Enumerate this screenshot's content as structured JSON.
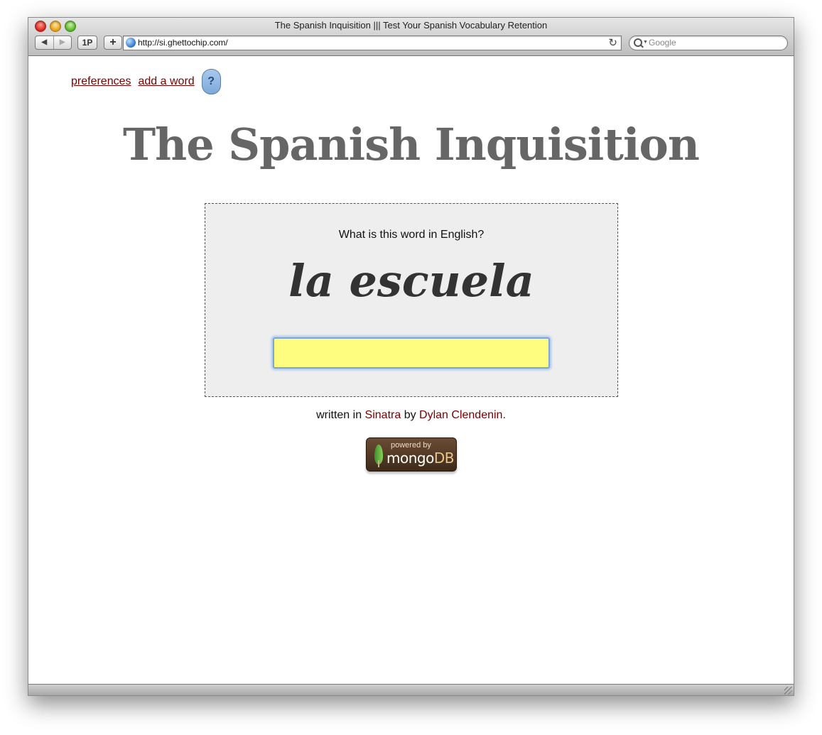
{
  "window": {
    "title": "The Spanish Inquisition ||| Test Your Spanish Vocabulary Retention"
  },
  "toolbar": {
    "back_label": "◀",
    "forward_label": "▶",
    "onepassword_label": "1P",
    "add_label": "+",
    "url": "http://si.ghettochip.com/",
    "reload_label": "↻",
    "search_placeholder": "Google"
  },
  "nav": {
    "preferences_label": "preferences",
    "add_word_label": "add a word",
    "help_label": "?"
  },
  "page": {
    "title": "The Spanish Inquisition"
  },
  "quiz": {
    "prompt": "What is this word in English?",
    "word": "la escuela",
    "answer_value": ""
  },
  "credits": {
    "prefix": "written in ",
    "framework": "Sinatra",
    "middle": " by ",
    "author": "Dylan Clendenin."
  },
  "badge": {
    "small_text": "powered by",
    "mongo_text": "mongo",
    "db_text": "DB"
  },
  "colors": {
    "link": "#7a0000",
    "title": "#666666",
    "input_bg": "#fffd80"
  }
}
